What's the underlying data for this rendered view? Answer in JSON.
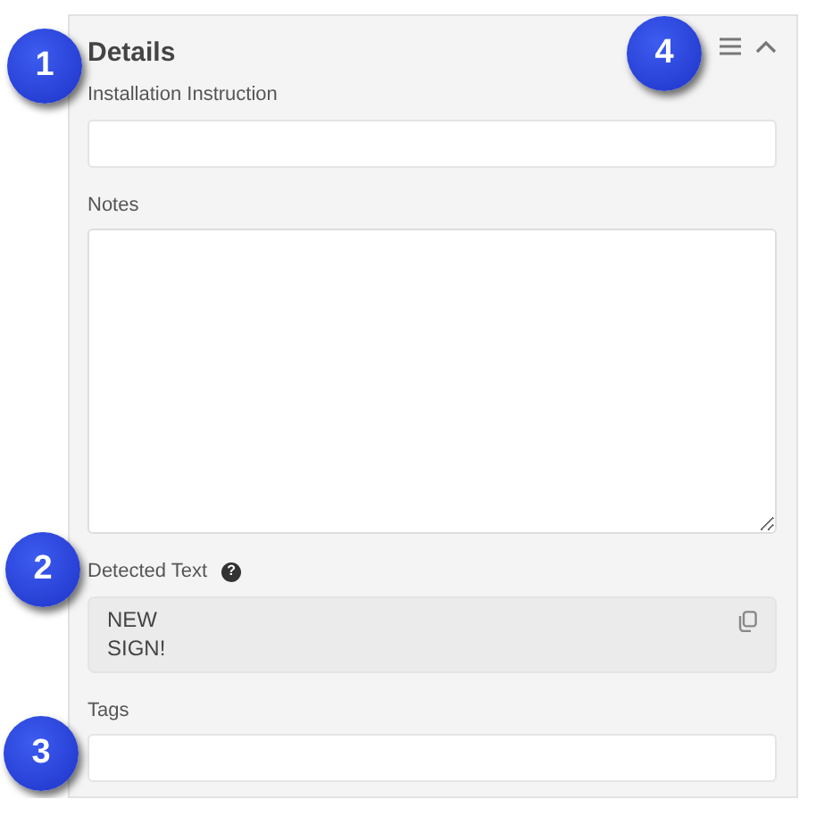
{
  "panel": {
    "title": "Details",
    "title_callout": "1",
    "actions_callout": "4",
    "expanded": true,
    "fields": [
      {
        "kind": "input",
        "label": "Installation Instruction"
      },
      {
        "kind": "textarea",
        "label": "Notes"
      },
      {
        "kind": "readonly",
        "label": "Detected Text",
        "help_icon": "?",
        "callout": "2",
        "lines": [
          "NEW",
          "SIGN!"
        ]
      },
      {
        "kind": "input",
        "label": "Tags",
        "callout": "3"
      }
    ]
  }
}
